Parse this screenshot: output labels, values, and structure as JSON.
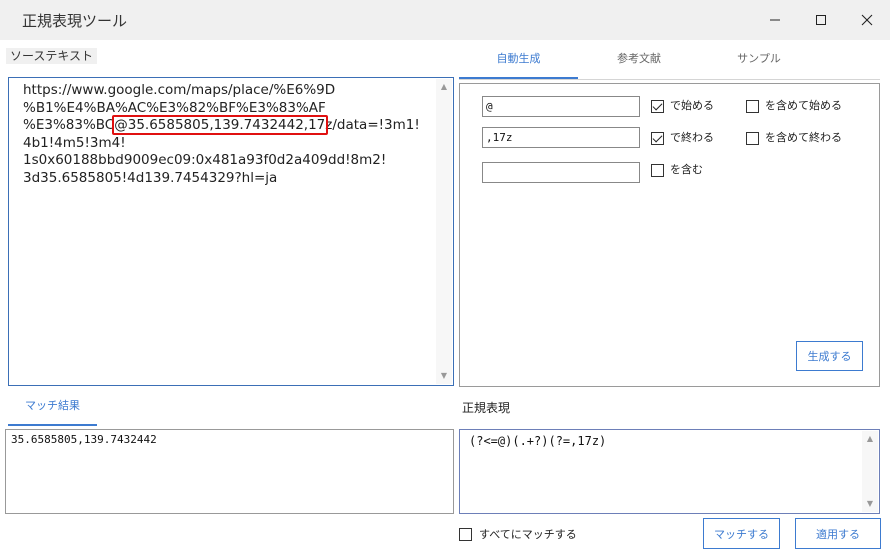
{
  "window": {
    "title": "正規表現ツール"
  },
  "source": {
    "label": "ソーステキスト",
    "text_before": "https://www.google.com/maps/place/%E6%9D\n%B1%E4%BA%AC%E3%82%BF%E3%83%AF\n%E3%83%BC",
    "text_highlight": "@35.6585805,139.7432442,17z",
    "text_after": "/data=!3m1!\n4b1!4m5!3m4!\n1s0x60188bbd9009ec09:0x481a93f0d2a409dd!8m2!\n3d35.6585805!4d139.7454329?hl=ja"
  },
  "tabs": [
    {
      "label": "自動生成",
      "active": true
    },
    {
      "label": "参考文献",
      "active": false
    },
    {
      "label": "サンプル",
      "active": false
    }
  ],
  "generate": {
    "start_value": "@",
    "end_value": ",17z",
    "contains_value": "",
    "starts_with_label": "で始める",
    "starts_with_checked": true,
    "include_start_label": "を含めて始める",
    "include_start_checked": false,
    "ends_with_label": "で終わる",
    "ends_with_checked": true,
    "include_end_label": "を含めて終わる",
    "include_end_checked": false,
    "contains_label": "を含む",
    "contains_checked": false,
    "generate_button": "生成する"
  },
  "match": {
    "tab_label": "マッチ結果",
    "result": "35.6585805,139.7432442"
  },
  "regex": {
    "label": "正規表現",
    "value": "(?<=@)(.+?)(?=,17z)"
  },
  "footer": {
    "match_all_label": "すべてにマッチする",
    "match_all_checked": false,
    "match_button": "マッチする",
    "apply_button": "適用する"
  },
  "colors": {
    "accent": "#3d7bd0",
    "highlight": "#e01010"
  }
}
